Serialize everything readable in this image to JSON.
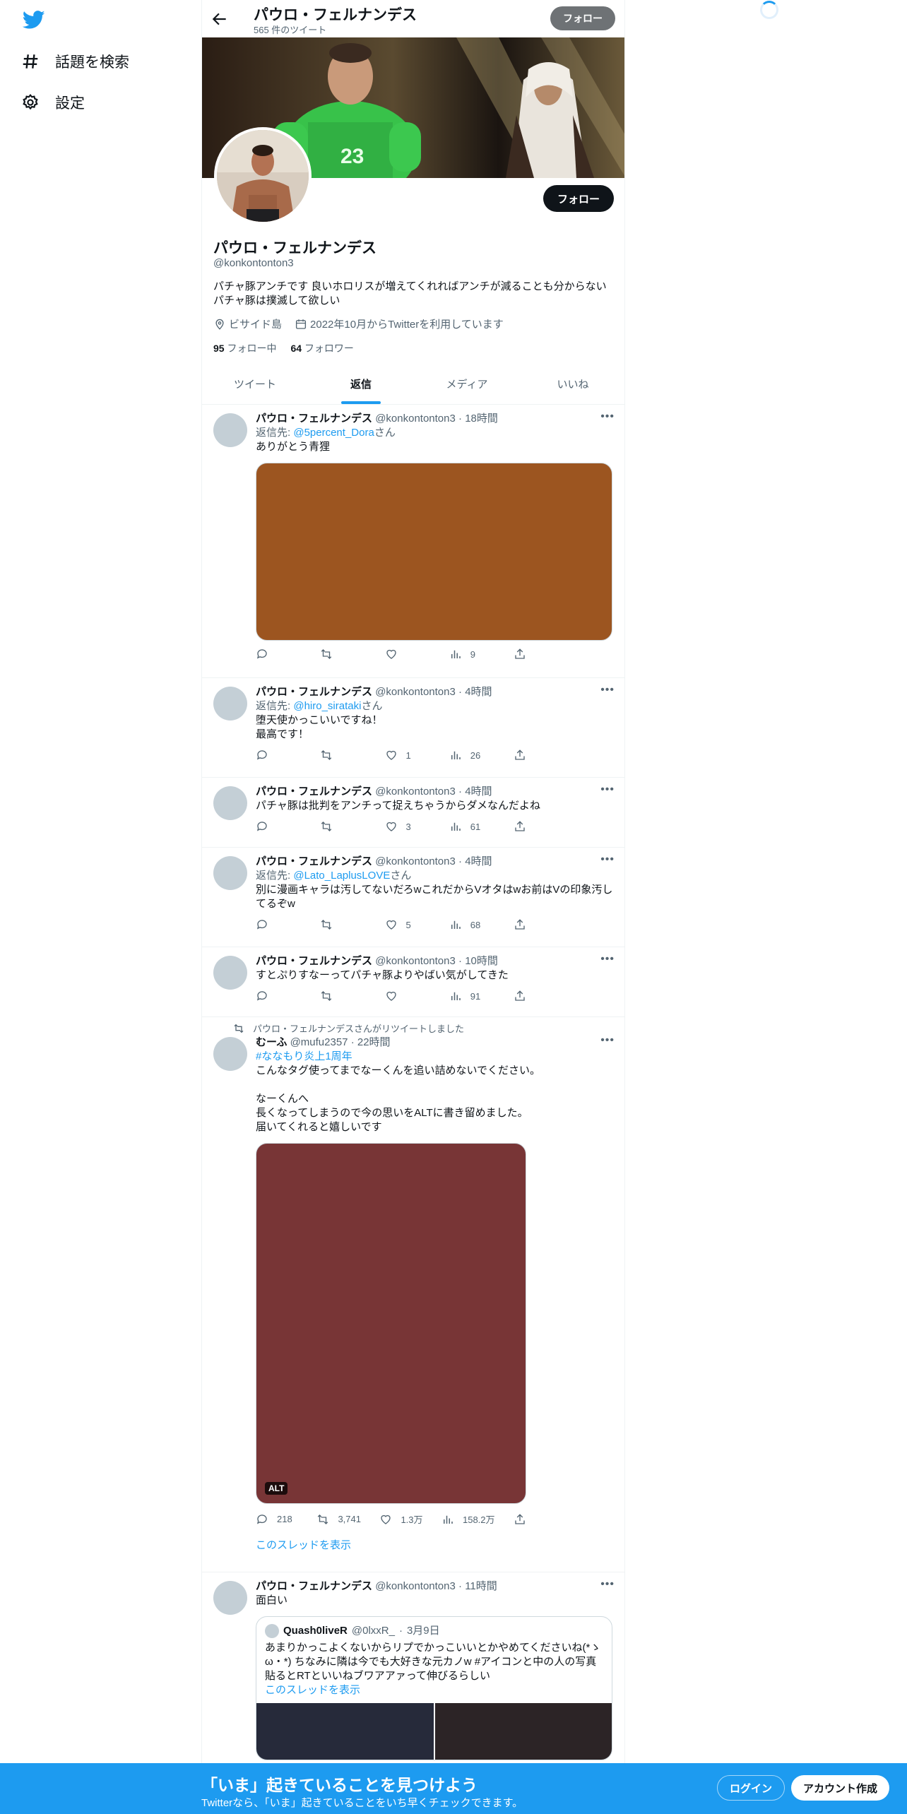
{
  "nav": {
    "items": [
      {
        "label": "話題を検索",
        "icon": "hashtag-icon"
      },
      {
        "label": "設定",
        "icon": "gear-icon"
      }
    ]
  },
  "header": {
    "name": "パウロ・フェルナンデス",
    "tweet_count": "565 件のツイート",
    "follow_label": "フォロー"
  },
  "profile": {
    "name": "パウロ・フェルナンデス",
    "handle": "@konkontonton3",
    "bio": "パチャ豚アンチです 良いホロリスが増えてくれればアンチが減ることも分からない\nパチャ豚は撲滅して欲しい",
    "location": "ビサイド島",
    "joined": "2022年10月からTwitterを利用しています",
    "following_count": "95",
    "following_label": "フォロー中",
    "followers_count": "64",
    "followers_label": "フォロワー",
    "follow_label": "フォロー"
  },
  "tabs": [
    "ツイート",
    "返信",
    "メディア",
    "いいね"
  ],
  "tweets": [
    {
      "name": "パウロ・フェルナンデス",
      "handle": "@konkontonton3",
      "time": "18時間",
      "reply_prefix": "返信先: ",
      "reply_to": "@5percent_Dora",
      "reply_suffix": "さん",
      "text": "ありがとう青狸",
      "media_color": "#9c5520",
      "replies": "",
      "retweets": "",
      "likes": "",
      "views": "9"
    },
    {
      "name": "パウロ・フェルナンデス",
      "handle": "@konkontonton3",
      "time": "4時間",
      "reply_prefix": "返信先: ",
      "reply_to": "@hiro_sirataki",
      "reply_suffix": "さん",
      "text": "堕天使かっこいいですね！\n最高です！",
      "replies": "",
      "retweets": "",
      "likes": "1",
      "views": "26"
    },
    {
      "name": "パウロ・フェルナンデス",
      "handle": "@konkontonton3",
      "time": "4時間",
      "text": "パチャ豚は批判をアンチって捉えちゃうからダメなんだよね",
      "replies": "",
      "retweets": "",
      "likes": "3",
      "views": "61"
    },
    {
      "name": "パウロ・フェルナンデス",
      "handle": "@konkontonton3",
      "time": "4時間",
      "reply_prefix": "返信先: ",
      "reply_to": "@Lato_LaplusLOVE",
      "reply_suffix": "さん",
      "text": "別に漫画キャラは汚してないだろwこれだからVオタはwお前はVの印象汚してるぞw",
      "replies": "",
      "retweets": "",
      "likes": "5",
      "views": "68"
    },
    {
      "name": "パウロ・フェルナンデス",
      "handle": "@konkontonton3",
      "time": "10時間",
      "text": "すとぷりすなーってパチャ豚よりやばい気がしてきた",
      "replies": "",
      "retweets": "",
      "likes": "",
      "views": "91"
    },
    {
      "retweeted_by": "パウロ・フェルナンデスさんがリツイートしました",
      "name": "むーふ",
      "handle": "@mufu2357",
      "time": "22時間",
      "hashtag": "#ななもり炎上1周年",
      "text": "こんなタグ使ってまでなーくんを追い詰めないでください。\n\nなーくんへ\n長くなってしまうので今の思いをALTに書き留めました。\n届いてくれると嬉しいです",
      "media_color": "#783536",
      "alt_label": "ALT",
      "replies": "218",
      "retweets": "3,741",
      "likes": "1.3万",
      "views": "158.2万",
      "show_thread": "このスレッドを表示"
    },
    {
      "name": "パウロ・フェルナンデス",
      "handle": "@konkontonton3",
      "time": "11時間",
      "text": "面白い",
      "quote": {
        "name": "Quash0liveR",
        "handle": "@0lxxR_",
        "time": "3月9日",
        "text": "あまりかっこよくないからリプでかっこいいとかやめてくださいね(*ゝω・*) ちなみに隣は今でも大好きな元カノw #アイコンと中の人の写真貼るとRTといいねブワアアァって伸びるらしい",
        "show_thread": "このスレッドを表示"
      }
    }
  ],
  "bottom_bar": {
    "title": "「いま」起きていることを見つけよう",
    "subtitle": "Twitterなら、「いま」起きていることをいち早くチェックできます。",
    "login": "ログイン",
    "signup": "アカウント作成"
  },
  "colors": {
    "accent": "#1d9bf0",
    "text": "#0f1419",
    "muted": "#536471"
  }
}
